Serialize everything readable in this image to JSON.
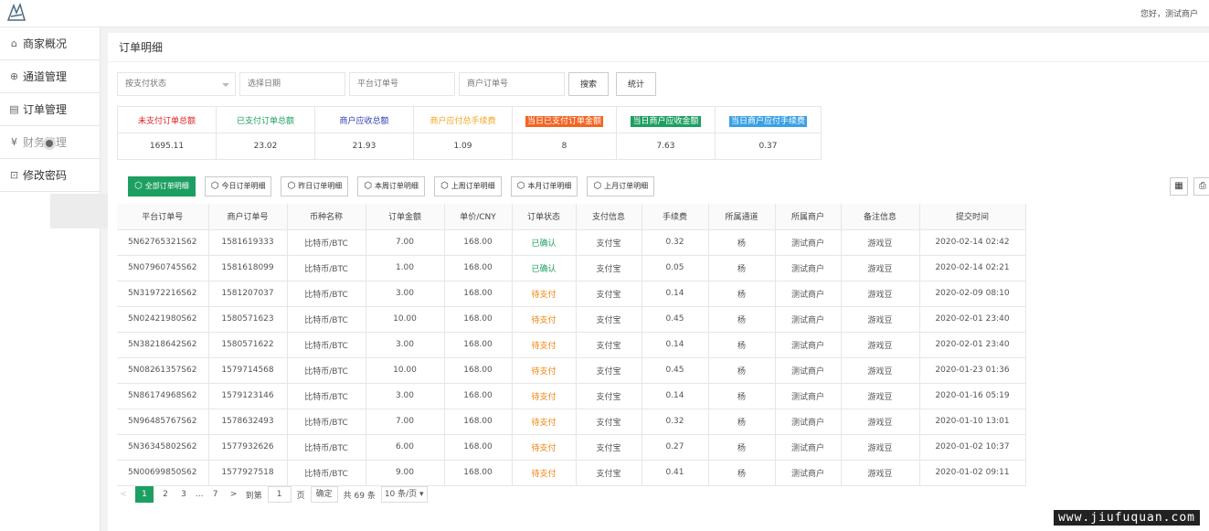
{
  "header": {
    "greeting": "您好，测试商户",
    "logo_icon": "wuxia-logo-icon"
  },
  "sidebar": {
    "items": [
      {
        "label": "商家概况",
        "icon": "home-icon"
      },
      {
        "label": "通道管理",
        "icon": "compass-icon"
      },
      {
        "label": "订单管理",
        "icon": "document-icon"
      },
      {
        "label": "财务管理",
        "icon": "yen-icon"
      },
      {
        "label": "修改密码",
        "icon": "lock-icon"
      }
    ]
  },
  "page": {
    "title": "订单明细"
  },
  "filters": {
    "status_select": "按支付状态",
    "date_placeholder": "选择日期",
    "platform_order_placeholder": "平台订单号",
    "merchant_order_placeholder": "商户订单号",
    "search_label": "搜索",
    "stats_label": "统计"
  },
  "summary": {
    "headers": [
      {
        "label": "未支付订单总额",
        "color": "#e02020",
        "bg": ""
      },
      {
        "label": "已支付订单总额",
        "color": "#1e9f62",
        "bg": ""
      },
      {
        "label": "商户应收总额",
        "color": "#2f3fb8",
        "bg": ""
      },
      {
        "label": "商户应付总手续费",
        "color": "#f5a623",
        "bg": ""
      },
      {
        "label": "当日已支付订单金额",
        "color": "#ffffff",
        "bg": "#f26522"
      },
      {
        "label": "当日商户应收金额",
        "color": "#ffffff",
        "bg": "#1e9f62"
      },
      {
        "label": "当日商户应付手续费",
        "color": "#ffffff",
        "bg": "#3aa0e6"
      }
    ],
    "values": [
      "1695.11",
      "23.02",
      "21.93",
      "1.09",
      "8",
      "7.63",
      "0.37"
    ]
  },
  "range_buttons": [
    {
      "label": "全部订单明细",
      "active": true
    },
    {
      "label": "今日订单明细",
      "active": false
    },
    {
      "label": "昨日订单明细",
      "active": false
    },
    {
      "label": "本周订单明细",
      "active": false
    },
    {
      "label": "上周订单明细",
      "active": false
    },
    {
      "label": "本月订单明细",
      "active": false
    },
    {
      "label": "上月订单明细",
      "active": false
    }
  ],
  "tools": {
    "columns_icon": "columns-icon",
    "print_icon": "print-icon"
  },
  "table": {
    "columns": [
      "平台订单号",
      "商户订单号",
      "币种名称",
      "订单金额",
      "单价/CNY",
      "订单状态",
      "支付信息",
      "手续费",
      "所属通道",
      "所属商户",
      "备注信息",
      "提交时间"
    ],
    "rows": [
      [
        "5N62765321S62",
        "1581619333",
        "比特币/BTC",
        "7.00",
        "168.00",
        "已确认",
        "支付宝",
        "0.32",
        "杨",
        "测试商户",
        "游戏豆",
        "2020-02-14 02:42"
      ],
      [
        "5N07960745S62",
        "1581618099",
        "比特币/BTC",
        "1.00",
        "168.00",
        "已确认",
        "支付宝",
        "0.05",
        "杨",
        "测试商户",
        "游戏豆",
        "2020-02-14 02:21"
      ],
      [
        "5N31972216S62",
        "1581207037",
        "比特币/BTC",
        "3.00",
        "168.00",
        "待支付",
        "支付宝",
        "0.14",
        "杨",
        "测试商户",
        "游戏豆",
        "2020-02-09 08:10"
      ],
      [
        "5N02421980S62",
        "1580571623",
        "比特币/BTC",
        "10.00",
        "168.00",
        "待支付",
        "支付宝",
        "0.45",
        "杨",
        "测试商户",
        "游戏豆",
        "2020-02-01 23:40"
      ],
      [
        "5N38218642S62",
        "1580571622",
        "比特币/BTC",
        "3.00",
        "168.00",
        "待支付",
        "支付宝",
        "0.14",
        "杨",
        "测试商户",
        "游戏豆",
        "2020-02-01 23:40"
      ],
      [
        "5N08261357S62",
        "1579714568",
        "比特币/BTC",
        "10.00",
        "168.00",
        "待支付",
        "支付宝",
        "0.45",
        "杨",
        "测试商户",
        "游戏豆",
        "2020-01-23 01:36"
      ],
      [
        "5N86174968S62",
        "1579123146",
        "比特币/BTC",
        "3.00",
        "168.00",
        "待支付",
        "支付宝",
        "0.14",
        "杨",
        "测试商户",
        "游戏豆",
        "2020-01-16 05:19"
      ],
      [
        "5N96485767S62",
        "1578632493",
        "比特币/BTC",
        "7.00",
        "168.00",
        "待支付",
        "支付宝",
        "0.32",
        "杨",
        "测试商户",
        "游戏豆",
        "2020-01-10 13:01"
      ],
      [
        "5N36345802S62",
        "1577932626",
        "比特币/BTC",
        "6.00",
        "168.00",
        "待支付",
        "支付宝",
        "0.27",
        "杨",
        "测试商户",
        "游戏豆",
        "2020-01-02 10:37"
      ],
      [
        "5N00699850S62",
        "1577927518",
        "比特币/BTC",
        "9.00",
        "168.00",
        "待支付",
        "支付宝",
        "0.41",
        "杨",
        "测试商户",
        "游戏豆",
        "2020-01-02 09:11"
      ]
    ]
  },
  "pagination": {
    "prev": "<",
    "pages": [
      "1",
      "2",
      "3"
    ],
    "ellipsis": "...",
    "last": "7",
    "next": ">",
    "goto_label": "到第",
    "goto_value": "1",
    "page_unit": "页",
    "confirm_label": "确定",
    "total_label": "共 69 条",
    "page_size": "10 条/页 ▾"
  },
  "watermark": "www.jiufuquan.com"
}
